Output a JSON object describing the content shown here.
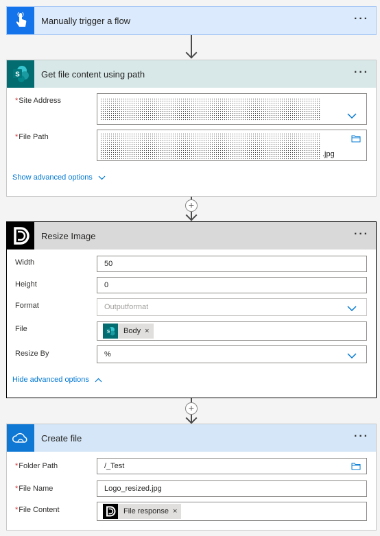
{
  "steps": {
    "trigger": {
      "title": "Manually trigger a flow",
      "more": "···",
      "icon": "touch-hand-icon",
      "color": "#1273eb"
    },
    "get_file": {
      "title": "Get file content using path",
      "more": "···",
      "icon": "sharepoint-icon",
      "color": "#036c70",
      "fields": {
        "site_address": {
          "label": "Site Address",
          "required_mark": "*"
        },
        "file_path": {
          "label": "File Path",
          "required_mark": "*",
          "suffix": ".jpg"
        }
      },
      "advanced_link": "Show advanced options"
    },
    "resize": {
      "title": "Resize Image",
      "more": "···",
      "icon": "encodian-logo-icon",
      "fields": {
        "width": {
          "label": "Width",
          "value": "50"
        },
        "height": {
          "label": "Height",
          "value": "0"
        },
        "format": {
          "label": "Format",
          "placeholder": "Outputformat"
        },
        "file": {
          "label": "File",
          "token": "Body",
          "token_icon_text": "S",
          "remove": "×"
        },
        "resize_by": {
          "label": "Resize By",
          "value": "%"
        }
      },
      "advanced_link": "Hide advanced options"
    },
    "create_file": {
      "title": "Create file",
      "more": "···",
      "icon": "onedrive-cloud-icon",
      "fields": {
        "folder_path": {
          "label": "Folder Path",
          "required_mark": "*",
          "value": "/_Test"
        },
        "file_name": {
          "label": "File Name",
          "required_mark": "*",
          "value": "Logo_resized.jpg"
        },
        "file_content": {
          "label": "File Content",
          "required_mark": "*",
          "token": "File response",
          "remove": "×"
        }
      }
    }
  },
  "add_step_symbol": "+"
}
